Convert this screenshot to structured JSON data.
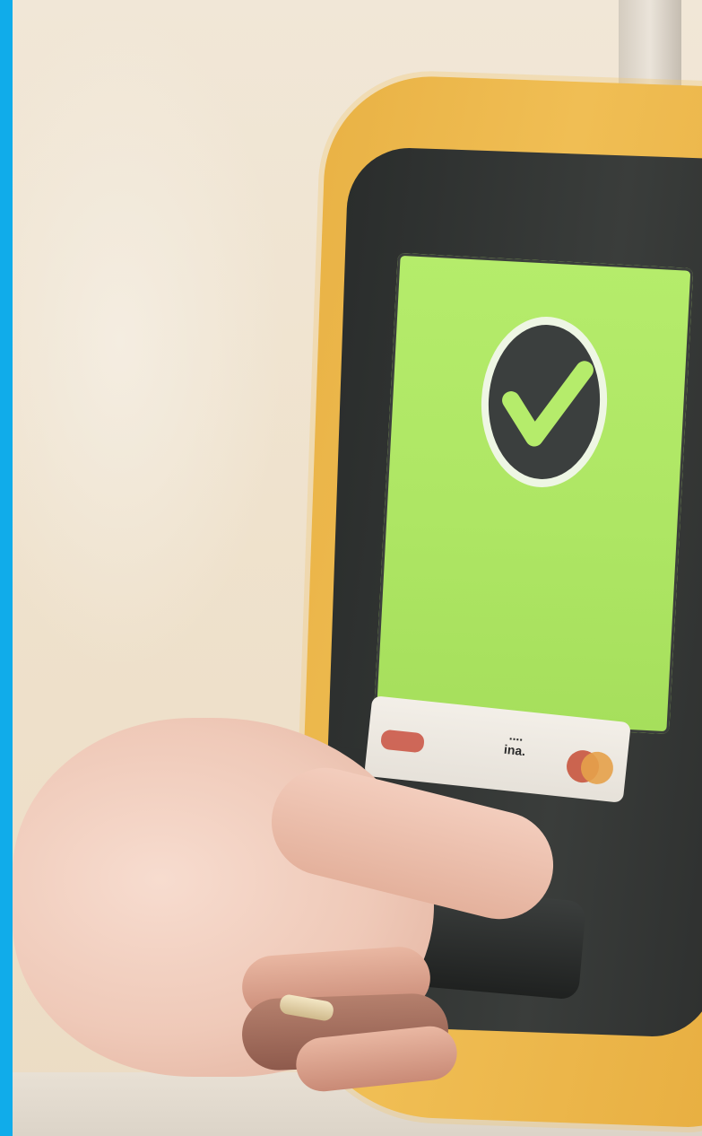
{
  "image": {
    "colors": {
      "accent_bar": "#10acea",
      "reader_body": "#eeb84c",
      "screen": "#afe766",
      "check": "#3b3f3e"
    },
    "screen": {
      "status_icon": "checkmark-circle-icon"
    },
    "card_strip": {
      "center_label_line1": "....",
      "center_label_line2": "ina."
    }
  }
}
